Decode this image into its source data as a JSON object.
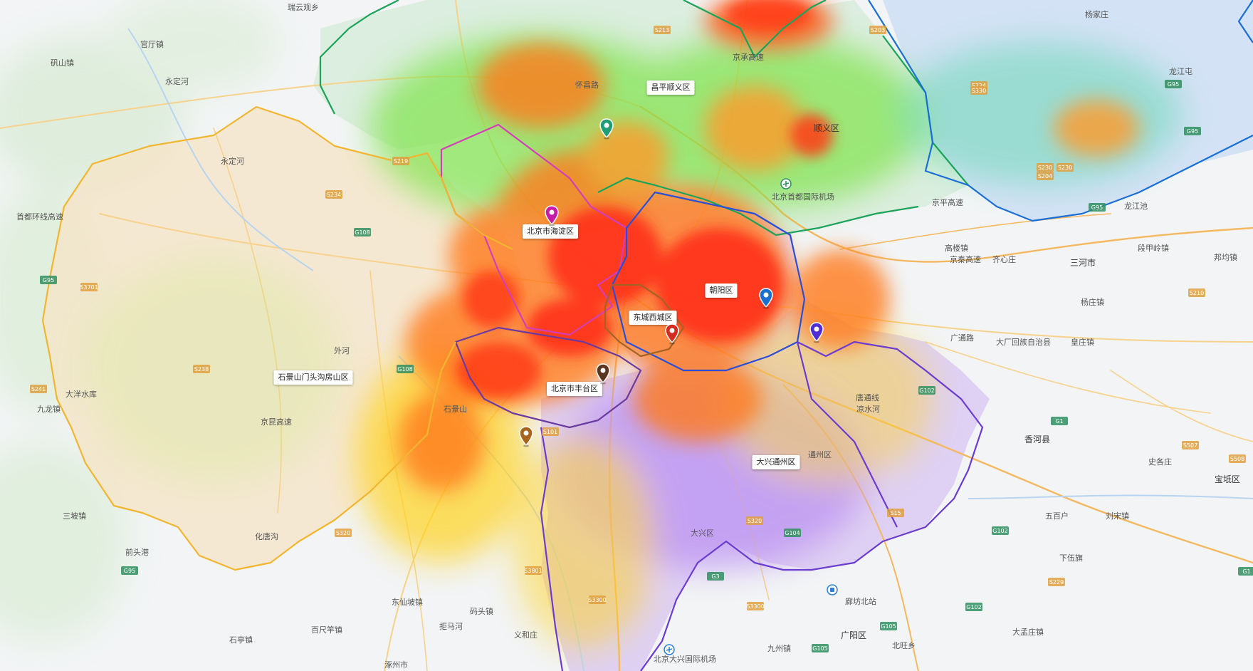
{
  "map": {
    "district_labels": {
      "changping_shunyi": "昌平顺义区",
      "haidian": "北京市海淀区",
      "chaoyang": "朝阳区",
      "dongcheng_xicheng": "东城西城区",
      "fengtai": "北京市丰台区",
      "daxing_tongzhou": "大兴通州区",
      "shijingshan_mentougou_fangshan": "石景山门头沟房山区"
    },
    "place_names": {
      "p1": "瑞云观乡",
      "p2": "官厅镇",
      "p3": "矾山镇",
      "p4": "永定河",
      "p5": "九龙镇",
      "p6": "大洋水库",
      "p7": "三坡镇",
      "p8": "前头港",
      "p9": "石亭镇",
      "p10": "百尺竿镇",
      "p11": "化唐沟",
      "p12": "外河",
      "p13": "东仙坡镇",
      "p14": "码头镇",
      "p15": "义和庄",
      "p16": "拒马河",
      "p17": "涿州市",
      "p18": "北京大兴国际机场",
      "p19": "九州镇",
      "p20": "广阳区",
      "p21": "北旺乡",
      "p22": "大孟庄镇",
      "p23": "廊坊北站",
      "p24": "香河县",
      "p25": "史各庄",
      "p26": "宝坻区",
      "p27": "五百户",
      "p28": "刘宋镇",
      "p29": "下伍旗",
      "p30": "大厂回族自治县",
      "p31": "皇庄镇",
      "p32": "三河市",
      "p33": "杨庄镇",
      "p34": "段甲岭镇",
      "p35": "邦均镇",
      "p36": "龙江池",
      "p37": "高楼镇",
      "p38": "齐心庄",
      "p39": "京秦高速",
      "p40": "广通路",
      "p41": "唐通线",
      "p42": "凉水河",
      "p43": "北京首都国际机场",
      "p44": "永定河",
      "p45": "京昆高速",
      "p46": "顺义区",
      "p47": "怀昌路",
      "p48": "京承高速",
      "p49": "龙江屯",
      "p50": "杨家庄",
      "p51": "首都环线高速",
      "p52": "京平高速",
      "p53": "石景山",
      "p54": "通州区",
      "p55": "大兴区"
    },
    "route_shields": [
      "S213",
      "S203",
      "G95",
      "S224",
      "S330",
      "S219",
      "G95",
      "S204",
      "S230",
      "G95",
      "S234",
      "G108",
      "S101",
      "G95",
      "S3701",
      "G108",
      "S238",
      "S241",
      "G95",
      "S320",
      "S3801",
      "S3300",
      "S320",
      "G3",
      "S15",
      "G1",
      "S507",
      "G102",
      "G102",
      "S229",
      "S210",
      "G1",
      "S508",
      "G105",
      "G104",
      "S3300",
      "G102",
      "G105",
      "S230"
    ],
    "markers": [
      {
        "name": "changping-shunyi",
        "color": "#1f9e76"
      },
      {
        "name": "haidian",
        "color": "#c71ca7"
      },
      {
        "name": "chaoyang",
        "color": "#1b6fd1"
      },
      {
        "name": "tongzhou",
        "color": "#4f2ed6"
      },
      {
        "name": "dongcheng-xicheng",
        "color": "#d42b20"
      },
      {
        "name": "fengtai",
        "color": "#5a3520"
      },
      {
        "name": "fangshan",
        "color": "#a8641d"
      }
    ],
    "boundary_colors": {
      "changping_shunyi": "#1ba35a",
      "pinggu_miyun": "#1a6fd6",
      "haidian": "#d23fb8",
      "chaoyang": "#2a4fd6",
      "dongxi": "#a56124",
      "fengtai": "#6a3aa0",
      "daxing_tongzhou": "#6b3ccf",
      "west": "#f2b530"
    },
    "heat_colors": [
      "#ff2a12",
      "#ff7a1a",
      "#ffd21f",
      "#7ee34a",
      "#4bd4a2",
      "#b98ef2"
    ]
  }
}
